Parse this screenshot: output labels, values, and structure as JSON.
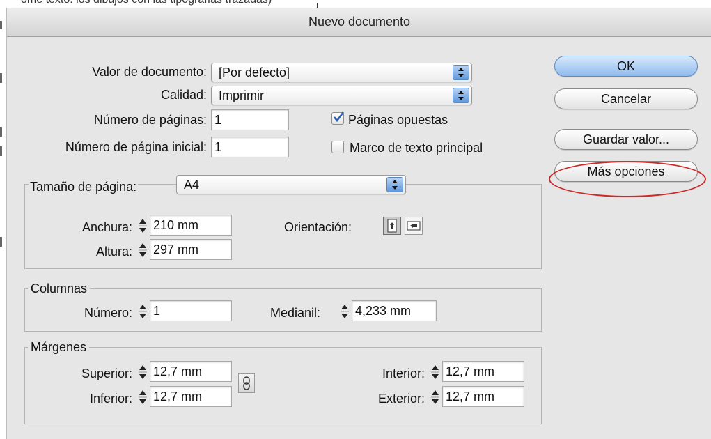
{
  "background": {
    "cut_off_text": "ome texto: los dibujos con las tipografías trazadas)"
  },
  "dialog": {
    "title": "Nuevo documento",
    "document_preset": {
      "label": "Valor de documento:",
      "value": "[Por defecto]"
    },
    "intent": {
      "label": "Calidad:",
      "value": "Imprimir"
    },
    "num_pages": {
      "label": "Número de páginas:",
      "value": "1"
    },
    "start_page": {
      "label": "Número de página inicial:",
      "value": "1"
    },
    "facing_pages": {
      "label": "Páginas opuestas",
      "checked": true
    },
    "master_text_frame": {
      "label": "Marco de texto principal",
      "checked": false
    },
    "page_size": {
      "label": "Tamaño de página:",
      "value": "A4",
      "width": {
        "label": "Anchura:",
        "value": "210 mm"
      },
      "height": {
        "label": "Altura:",
        "value": "297 mm"
      },
      "orientation": {
        "label": "Orientación:",
        "selected": "portrait"
      }
    },
    "columns": {
      "legend": "Columnas",
      "number": {
        "label": "Número:",
        "value": "1"
      },
      "gutter": {
        "label": "Medianil:",
        "value": "4,233 mm"
      }
    },
    "margins": {
      "legend": "Márgenes",
      "top": {
        "label": "Superior:",
        "value": "12,7 mm"
      },
      "bottom": {
        "label": "Inferior:",
        "value": "12,7 mm"
      },
      "inside": {
        "label": "Interior:",
        "value": "12,7 mm"
      },
      "outside": {
        "label": "Exterior:",
        "value": "12,7 mm"
      }
    },
    "buttons": {
      "ok": "OK",
      "cancel": "Cancelar",
      "save_preset": "Guardar valor...",
      "more_options": "Más opciones"
    }
  },
  "colors": {
    "window_bg": "#e6e6e6",
    "default_button": "#8fbbee",
    "highlight": "#cc2a2a",
    "popup_arrows": "#5d97dc"
  }
}
